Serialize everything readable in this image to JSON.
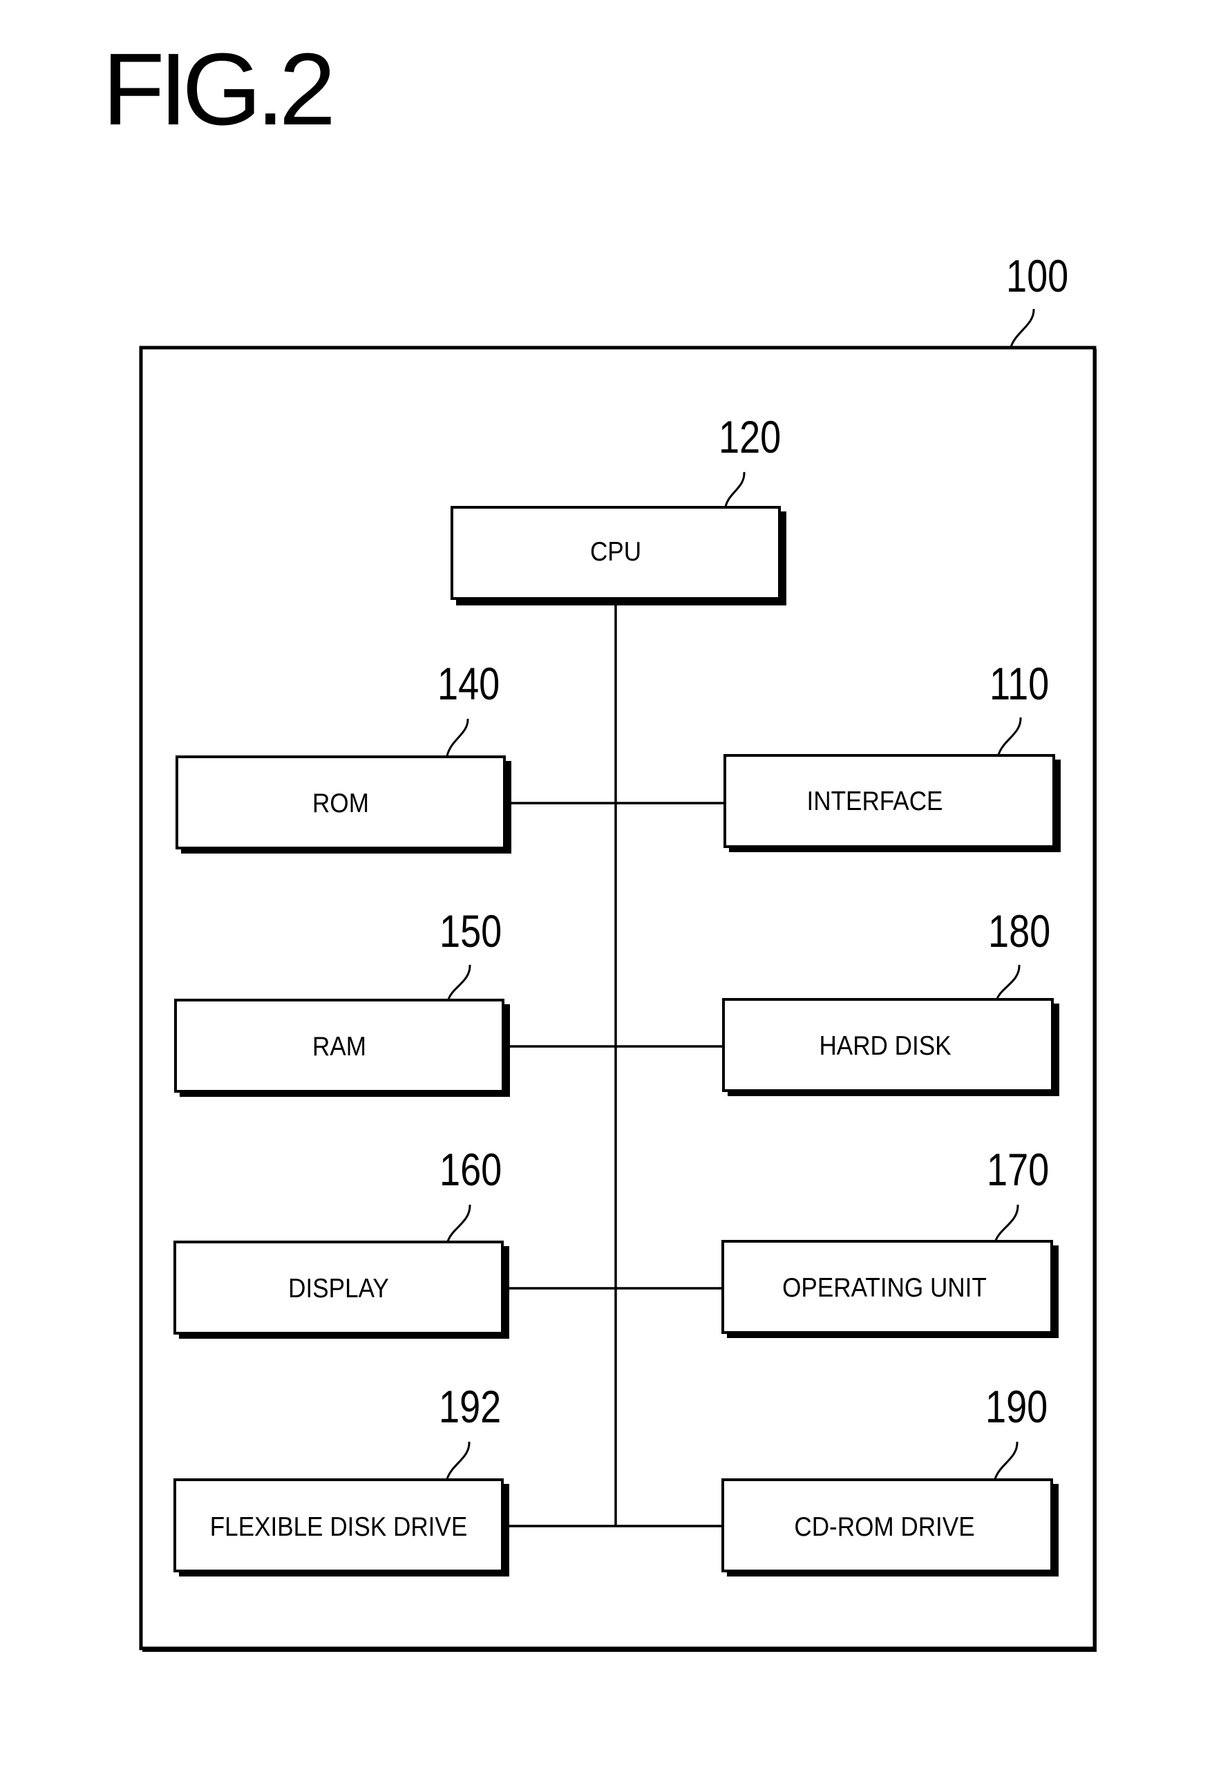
{
  "figure": {
    "title": "FIG.2",
    "system": {
      "ref": "100",
      "description": "computer system enclosure"
    },
    "blocks": [
      {
        "id": "cpu",
        "ref": "120",
        "label": "CPU"
      },
      {
        "id": "rom",
        "ref": "140",
        "label": "ROM"
      },
      {
        "id": "interface",
        "ref": "110",
        "label": "INTERFACE"
      },
      {
        "id": "ram",
        "ref": "150",
        "label": "RAM"
      },
      {
        "id": "hard-disk",
        "ref": "180",
        "label": "HARD DISK"
      },
      {
        "id": "display",
        "ref": "160",
        "label": "DISPLAY"
      },
      {
        "id": "operating-unit",
        "ref": "170",
        "label": "OPERATING UNIT"
      },
      {
        "id": "flexible-disk-drive",
        "ref": "192",
        "label": "FLEXIBLE DISK DRIVE"
      },
      {
        "id": "cd-rom-drive",
        "ref": "190",
        "label": "CD-ROM DRIVE"
      }
    ],
    "connections": [
      {
        "from": "cpu",
        "to": "bus"
      },
      {
        "from": "rom",
        "to": "interface",
        "via": "bus"
      },
      {
        "from": "ram",
        "to": "hard-disk",
        "via": "bus"
      },
      {
        "from": "display",
        "to": "operating-unit",
        "via": "bus"
      },
      {
        "from": "flexible-disk-drive",
        "to": "cd-rom-drive",
        "via": "bus"
      }
    ]
  }
}
